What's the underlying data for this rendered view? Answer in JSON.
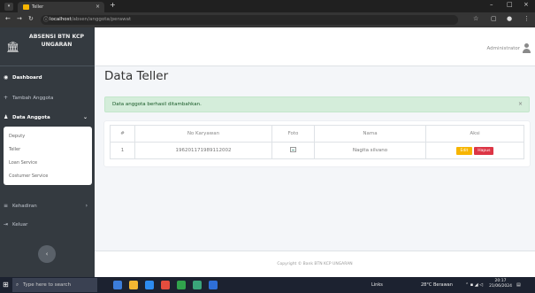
{
  "browser": {
    "tab_title": "Teller",
    "url_host": "localhost",
    "url_path": "/absen/anggota/perawat"
  },
  "sidebar": {
    "brand": "ABSENSI BTN KCP UNGARAN",
    "items": [
      {
        "label": "Dashboard",
        "icon": "dashboard-icon"
      },
      {
        "label": "Tambah Anggota",
        "icon": "add-user-icon"
      },
      {
        "label": "Data Anggota",
        "icon": "users-icon"
      },
      {
        "label": "Kehadiran",
        "icon": "list-icon"
      },
      {
        "label": "Keluar",
        "icon": "logout-icon"
      }
    ],
    "submenu": [
      "Deputy",
      "Teller",
      "Loan Service",
      "Costumer Service"
    ]
  },
  "topnav": {
    "user": "Administrator"
  },
  "page_title": "Data Teller",
  "alert": {
    "message": "Data anggota berhasil ditambahkan.",
    "close": "×"
  },
  "table": {
    "headers": [
      "#",
      "No Karyawan",
      "Foto",
      "Nama",
      "Aksi"
    ],
    "rows": [
      {
        "no": "1",
        "no_karyawan": "196201171989112002",
        "nama": "Nagita silvano",
        "edit": "Edit",
        "delete": "Hapus"
      }
    ]
  },
  "footer": "Copyright © Bank BTN KCP UNGARAN",
  "taskbar": {
    "search_placeholder": "Type here to search",
    "links": "Links",
    "weather": "28°C Berawan",
    "time": "20:17",
    "date": "21/06/2024"
  },
  "colors": {
    "sidebar_bg": "#343a40",
    "alert_bg": "#d4edda",
    "edit_button": "#f7b500",
    "delete_button": "#dc3545"
  }
}
